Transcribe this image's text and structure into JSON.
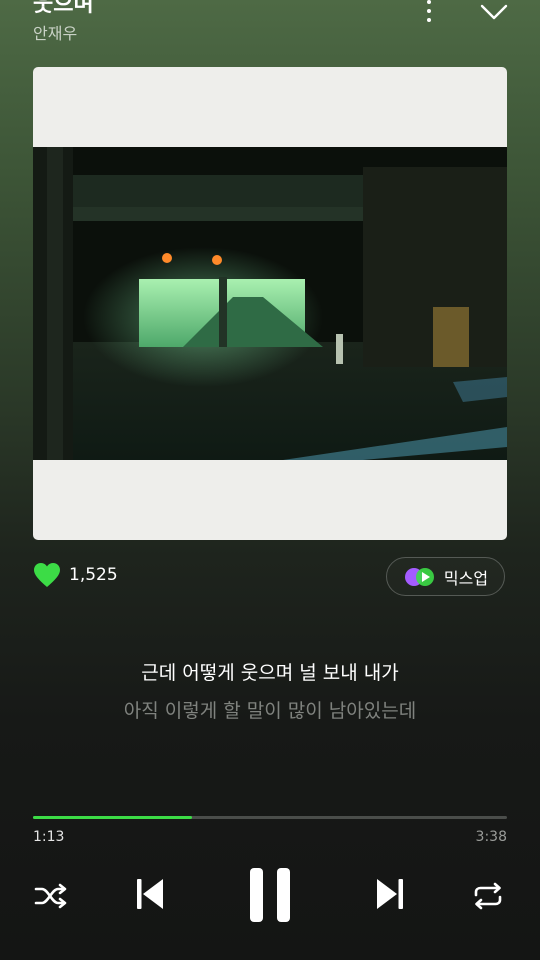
{
  "header": {
    "song_title": "웃으며",
    "artist": "안재우"
  },
  "icons": {
    "more": "more-vertical-icon",
    "collapse": "chevron-down-icon",
    "like": "heart-icon",
    "mixup": "mixup-icon",
    "shuffle": "shuffle-icon",
    "previous": "skip-previous-icon",
    "pause": "pause-icon",
    "next": "skip-next-icon",
    "repeat": "repeat-icon"
  },
  "like": {
    "count": "1,525",
    "color": "#3cdc46"
  },
  "mixup": {
    "label": "믹스업"
  },
  "lyrics": {
    "current": "근데 어떻게 웃으며 널 보내 내가",
    "next": "아직 이렇게 할 말이 많이 남아있는데"
  },
  "playback": {
    "elapsed": "1:13",
    "total": "3:38",
    "progress": 0.335,
    "accent_color": "#3cdc46"
  }
}
